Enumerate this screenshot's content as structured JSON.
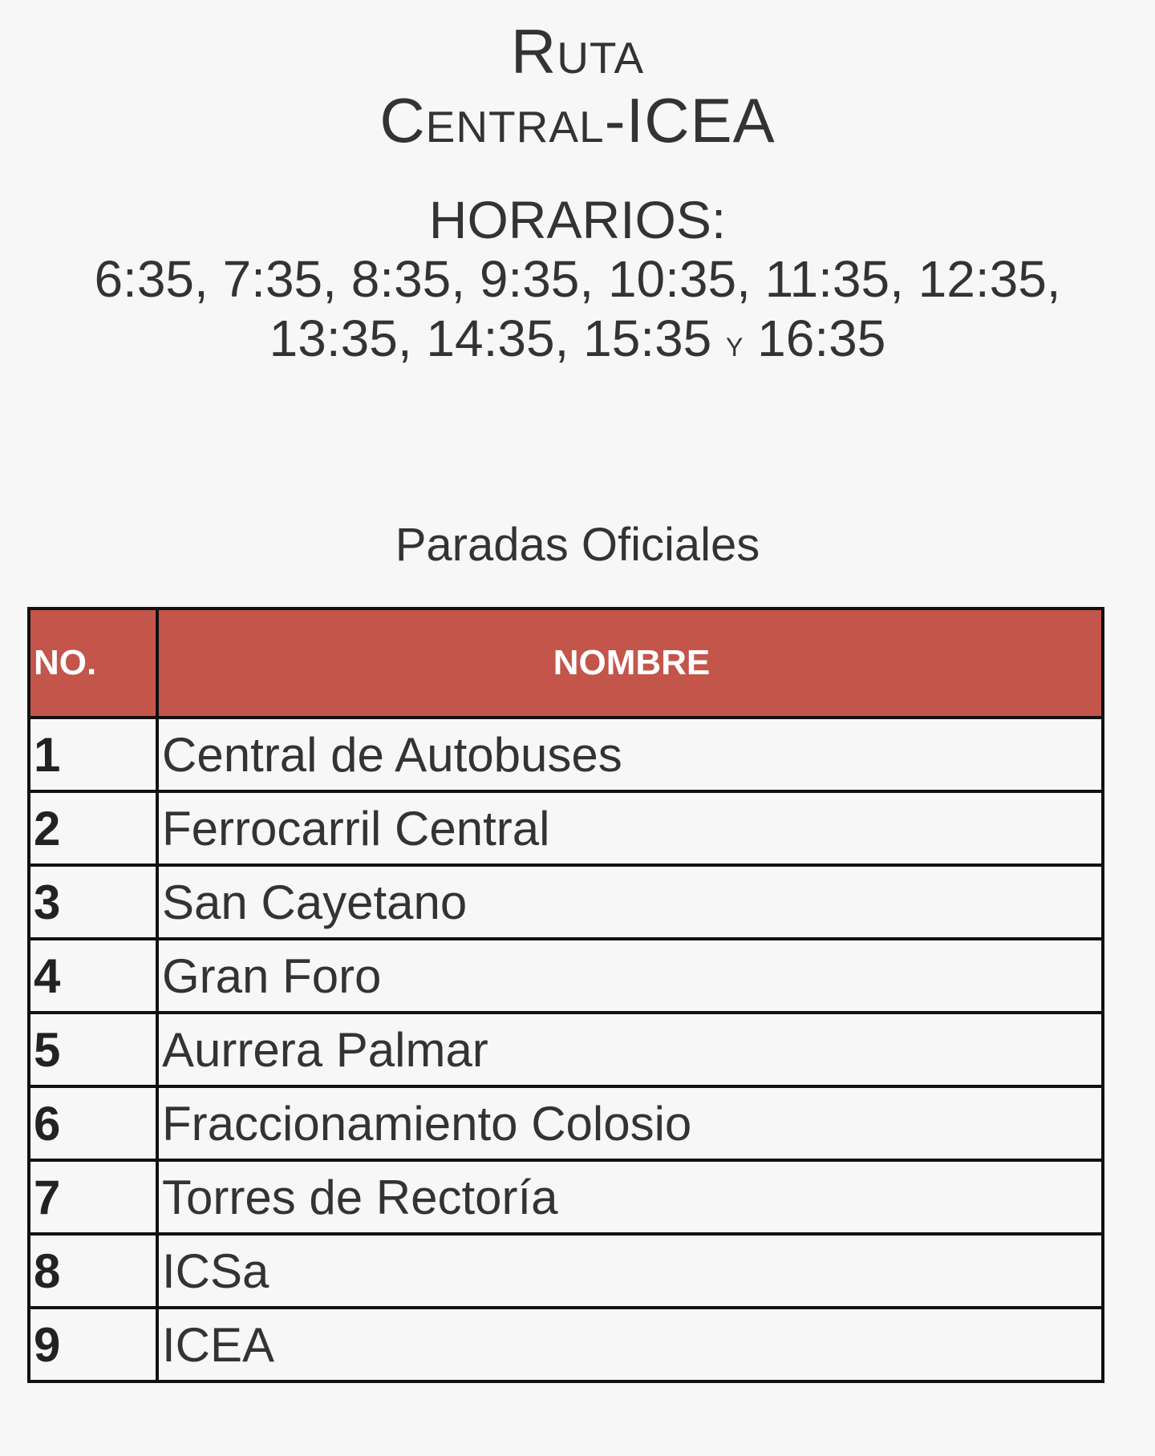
{
  "header": {
    "route_label": "Ruta",
    "route_name": "Central-ICEA"
  },
  "schedule": {
    "label": "HORARIOS:",
    "line1": "6:35, 7:35, 8:35, 9:35, 10:35, 11:35, 12:35,",
    "line2_times": "13:35, 14:35, 15:35",
    "line2_conjunction": "y",
    "line2_last": "16:35"
  },
  "stops_section": {
    "title": "Paradas Oficiales",
    "header_color": "#c4554b",
    "columns": [
      "NO.",
      "NOMBRE"
    ],
    "rows": [
      {
        "no": "1",
        "name": "Central de Autobuses"
      },
      {
        "no": "2",
        "name": "Ferrocarril Central"
      },
      {
        "no": "3",
        "name": "San Cayetano"
      },
      {
        "no": "4",
        "name": "Gran Foro"
      },
      {
        "no": "5",
        "name": "Aurrera Palmar"
      },
      {
        "no": "6",
        "name": "Fraccionamiento Colosio"
      },
      {
        "no": "7",
        "name": "Torres de Rectoría"
      },
      {
        "no": "8",
        "name": "ICSa"
      },
      {
        "no": "9",
        "name": "ICEA"
      }
    ]
  }
}
